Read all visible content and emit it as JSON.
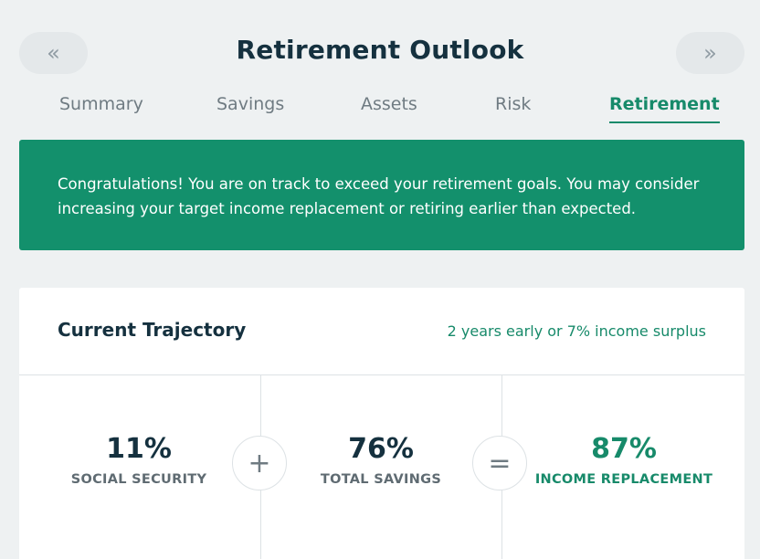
{
  "header": {
    "prev_icon": "«",
    "next_icon": "»",
    "title": "Retirement Outlook"
  },
  "tabs": [
    {
      "label": "Summary",
      "active": false
    },
    {
      "label": "Savings",
      "active": false
    },
    {
      "label": "Assets",
      "active": false
    },
    {
      "label": "Risk",
      "active": false
    },
    {
      "label": "Retirement",
      "active": true
    }
  ],
  "banner": {
    "message": "Congratulations! You are on track to exceed your retirement goals. You may consider increasing your target income replacement or retiring earlier than expected."
  },
  "trajectory": {
    "title": "Current Trajectory",
    "subtitle": "2 years early or 7% income surplus",
    "stats": [
      {
        "value": "11%",
        "label": "SOCIAL SECURITY"
      },
      {
        "value": "76%",
        "label": "TOTAL SAVINGS"
      },
      {
        "value": "87%",
        "label": "INCOME REPLACEMENT"
      }
    ],
    "operators": [
      "+",
      "="
    ]
  },
  "colors": {
    "accent": "#178a6a",
    "banner_bg": "#13906c",
    "page_bg": "#eef1f2",
    "heading": "#15313f"
  }
}
